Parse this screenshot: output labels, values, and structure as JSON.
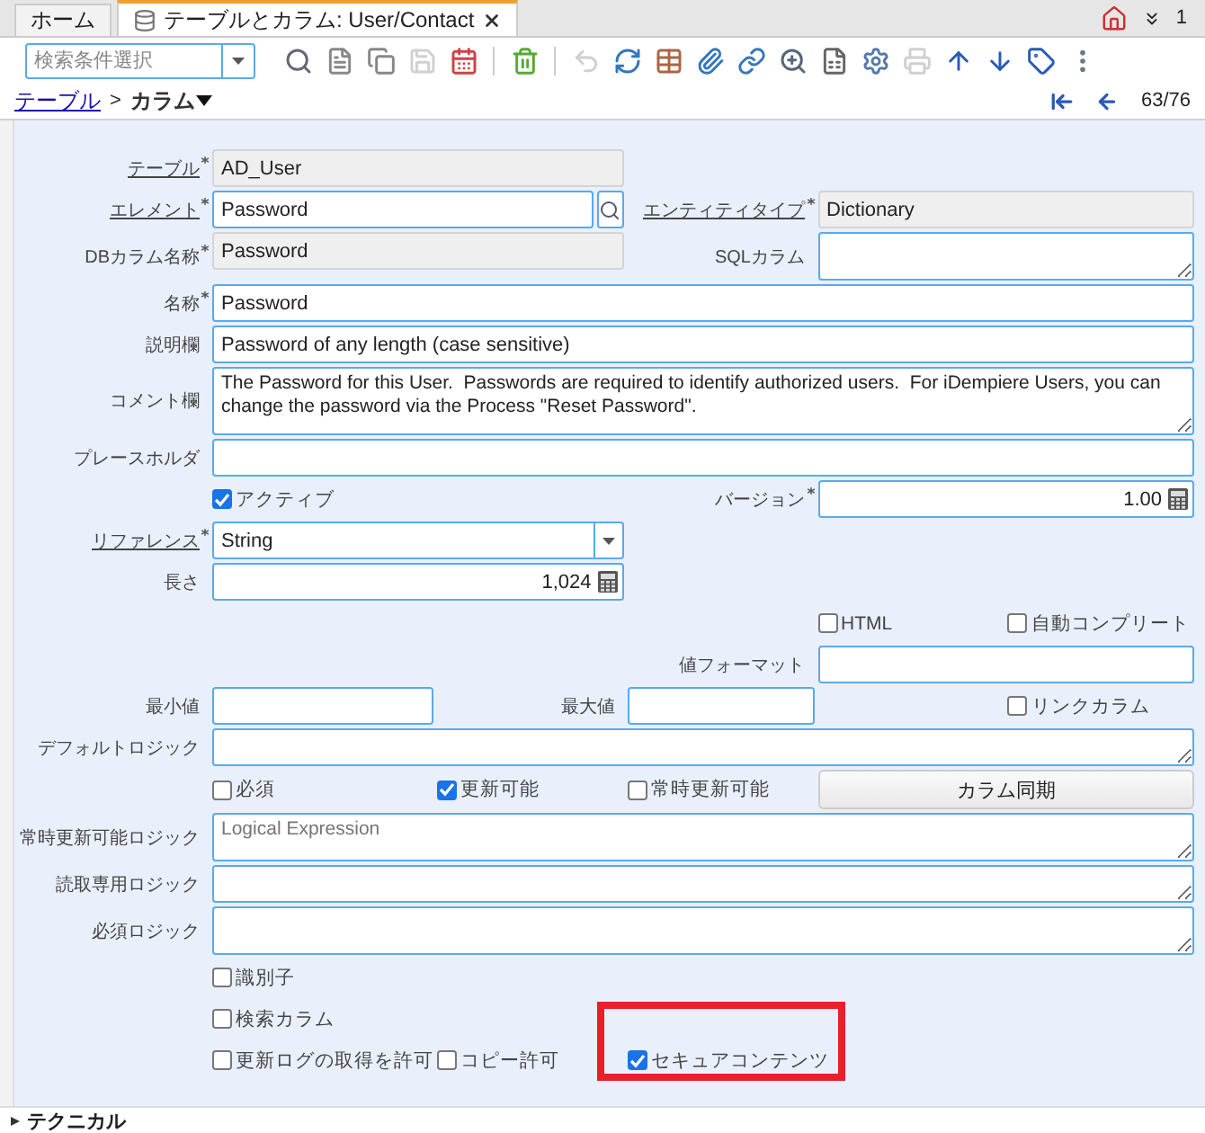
{
  "tabs": [
    {
      "label": "ホーム",
      "selected": false
    },
    {
      "label": "テーブルとカラム: User/Contact",
      "selected": true
    }
  ],
  "window_count": "1",
  "search": {
    "placeholder": "検索条件選択"
  },
  "toolbar": [
    {
      "kind": "search",
      "disabled": false
    },
    {
      "kind": "new",
      "disabled": false
    },
    {
      "kind": "copy",
      "disabled": false
    },
    {
      "kind": "save",
      "disabled": true
    },
    {
      "kind": "customize",
      "disabled": false
    },
    {
      "kind": "separator"
    },
    {
      "kind": "delete",
      "disabled": false
    },
    {
      "kind": "separator"
    },
    {
      "kind": "undo",
      "disabled": true
    },
    {
      "kind": "refresh",
      "disabled": false
    },
    {
      "kind": "grid",
      "disabled": false
    },
    {
      "kind": "attach",
      "disabled": false
    },
    {
      "kind": "chat",
      "disabled": false
    },
    {
      "kind": "zoom",
      "disabled": false
    },
    {
      "kind": "report",
      "disabled": false
    },
    {
      "kind": "process",
      "disabled": false
    },
    {
      "kind": "print",
      "disabled": true
    },
    {
      "kind": "up",
      "disabled": false
    },
    {
      "kind": "down",
      "disabled": false
    },
    {
      "kind": "tag",
      "disabled": false
    },
    {
      "kind": "more",
      "disabled": false
    }
  ],
  "breadcrumb": {
    "parent": "テーブル",
    "separator": ">",
    "current": "カラム"
  },
  "record_nav": "63/76",
  "rows": [
    [
      {
        "kind": "field",
        "label": "テーブル",
        "link": true,
        "required": true,
        "readonly": true,
        "value": "AD_User"
      }
    ],
    [
      {
        "kind": "search",
        "label": "エレメント",
        "link": true,
        "required": true,
        "readonly": false,
        "value": "Password"
      },
      {
        "kind": "field",
        "label": "エンティティタイプ",
        "link": true,
        "required": true,
        "readonly": true,
        "value": "Dictionary"
      }
    ],
    [
      {
        "kind": "field",
        "label": "DBカラム名称",
        "link": false,
        "required": true,
        "readonly": true,
        "value": "Password"
      },
      {
        "kind": "textarea",
        "label": "SQLカラム",
        "link": false,
        "required": false
      }
    ],
    [
      {
        "kind": "field",
        "label": "名称",
        "link": false,
        "required": true,
        "readonly": false,
        "value": "Password"
      }
    ],
    [
      {
        "kind": "field",
        "label": "説明欄",
        "link": false,
        "required": false,
        "readonly": false,
        "value": "Password of any length (case sensitive)"
      }
    ],
    [
      {
        "kind": "textarea",
        "label": "コメント欄",
        "link": false,
        "required": false,
        "value": "The Password for this User.  Passwords are required to identify authorized users.  For iDempiere Users, you can change the password via the Process \"Reset Password\"."
      }
    ],
    [
      {
        "kind": "field",
        "label": "プレースホルダ",
        "link": false,
        "required": false,
        "readonly": false
      }
    ],
    [
      {
        "kind": "checkbox",
        "label": "アクティブ",
        "checked": true
      },
      {
        "kind": "number",
        "label": "バージョン",
        "link": false,
        "required": true,
        "value": "1.00"
      }
    ],
    [
      {
        "kind": "select",
        "label": "リファレンス",
        "link": true,
        "required": true,
        "value": "String"
      }
    ],
    [
      {
        "kind": "number",
        "label": "長さ",
        "link": false,
        "required": false,
        "value": "1,024"
      }
    ],
    [
      {
        "kind": "checkbox",
        "label": "HTML",
        "checked": false
      },
      {
        "kind": "checkbox",
        "label": "自動コンプリート",
        "checked": false
      }
    ],
    [
      {
        "kind": "field",
        "label": "値フォーマット",
        "link": false,
        "required": false,
        "readonly": false
      }
    ],
    [
      {
        "kind": "field",
        "label": "最小値",
        "link": false,
        "required": false,
        "readonly": false
      },
      {
        "kind": "field",
        "label": "最大値",
        "link": false,
        "required": false,
        "readonly": false
      },
      {
        "kind": "checkbox",
        "label": "リンクカラム",
        "checked": false
      }
    ],
    [
      {
        "kind": "textarea",
        "label": "デフォルトロジック",
        "link": false,
        "required": false
      }
    ],
    [
      {
        "kind": "checkbox",
        "label": "必須",
        "checked": false
      },
      {
        "kind": "checkbox",
        "label": "更新可能",
        "checked": true
      },
      {
        "kind": "checkbox",
        "label": "常時更新可能",
        "checked": false
      },
      {
        "kind": "button",
        "label": "カラム同期"
      }
    ],
    [
      {
        "kind": "textarea",
        "label": "常時更新可能ロジック",
        "link": false,
        "required": false,
        "placeholder": "Logical Expression"
      }
    ],
    [
      {
        "kind": "textarea",
        "label": "読取専用ロジック",
        "link": false,
        "required": false
      }
    ],
    [
      {
        "kind": "textarea",
        "label": "必須ロジック",
        "link": false,
        "required": false
      }
    ],
    [
      {
        "kind": "checkbox",
        "label": "識別子",
        "checked": false
      }
    ],
    [
      {
        "kind": "checkbox",
        "label": "検索カラム",
        "checked": false
      }
    ],
    [
      {
        "kind": "checkbox",
        "label": "更新ログの取得を許可",
        "checked": false
      },
      {
        "kind": "checkbox",
        "label": "コピー許可",
        "checked": false
      },
      {
        "kind": "checkbox",
        "label": "セキュアコンテンツ",
        "checked": true,
        "highlighted": true
      }
    ]
  ],
  "section": {
    "label": "テクニカル",
    "expanded": false
  }
}
